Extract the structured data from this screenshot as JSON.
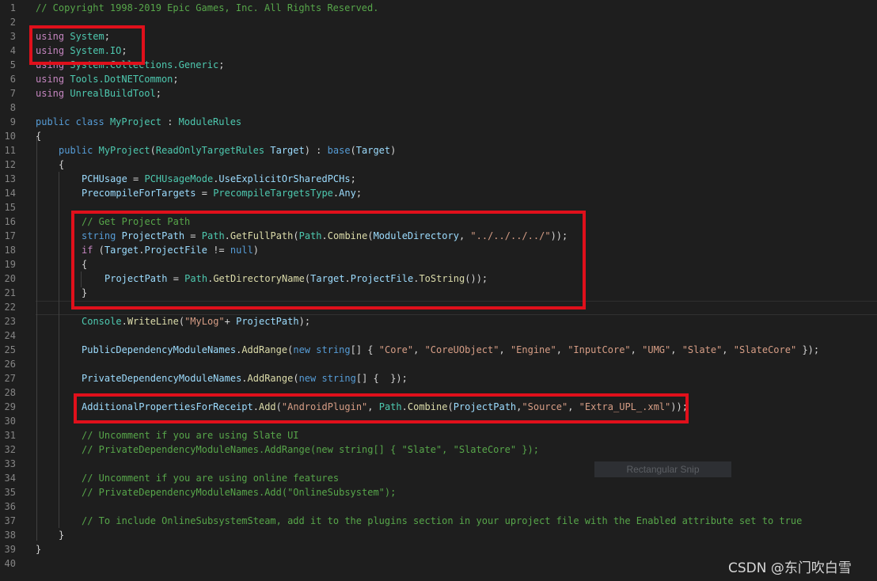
{
  "colors": {
    "comment": "#57a64a",
    "keyword": "#569cd6",
    "control": "#c586c0",
    "type": "#4ec9b0",
    "method": "#dcdcaa",
    "variable": "#9cdcfe",
    "string": "#d69d85",
    "plain": "#d4d4d4",
    "highlight_border": "#e0101b"
  },
  "lines": [
    {
      "n": "1",
      "indent": 0,
      "tokens": [
        [
          "c",
          "// Copyright 1998-2019 Epic Games, Inc. All Rights Reserved."
        ]
      ]
    },
    {
      "n": "2",
      "indent": 0,
      "tokens": []
    },
    {
      "n": "3",
      "indent": 0,
      "tokens": [
        [
          "ctl",
          "using"
        ],
        [
          "p",
          " "
        ],
        [
          "t",
          "System"
        ],
        [
          "p",
          ";"
        ]
      ]
    },
    {
      "n": "4",
      "indent": 0,
      "tokens": [
        [
          "ctl",
          "using"
        ],
        [
          "p",
          " "
        ],
        [
          "t",
          "System.IO"
        ],
        [
          "p",
          ";"
        ]
      ]
    },
    {
      "n": "5",
      "indent": 0,
      "tokens": [
        [
          "ctl",
          "using"
        ],
        [
          "p",
          " "
        ],
        [
          "t",
          "System.Collections.Generic"
        ],
        [
          "p",
          ";"
        ]
      ]
    },
    {
      "n": "6",
      "indent": 0,
      "tokens": [
        [
          "ctl",
          "using"
        ],
        [
          "p",
          " "
        ],
        [
          "t",
          "Tools.DotNETCommon"
        ],
        [
          "p",
          ";"
        ]
      ]
    },
    {
      "n": "7",
      "indent": 0,
      "tokens": [
        [
          "ctl",
          "using"
        ],
        [
          "p",
          " "
        ],
        [
          "t",
          "UnrealBuildTool"
        ],
        [
          "p",
          ";"
        ]
      ]
    },
    {
      "n": "8",
      "indent": 0,
      "tokens": []
    },
    {
      "n": "9",
      "indent": 0,
      "tokens": [
        [
          "k",
          "public"
        ],
        [
          "p",
          " "
        ],
        [
          "k",
          "class"
        ],
        [
          "p",
          " "
        ],
        [
          "t",
          "MyProject"
        ],
        [
          "p",
          " : "
        ],
        [
          "t",
          "ModuleRules"
        ]
      ]
    },
    {
      "n": "10",
      "indent": 0,
      "tokens": [
        [
          "p",
          "{"
        ]
      ]
    },
    {
      "n": "11",
      "indent": 1,
      "tokens": [
        [
          "k",
          "public"
        ],
        [
          "p",
          " "
        ],
        [
          "t",
          "MyProject"
        ],
        [
          "p",
          "("
        ],
        [
          "t",
          "ReadOnlyTargetRules"
        ],
        [
          "p",
          " "
        ],
        [
          "v",
          "Target"
        ],
        [
          "p",
          ") : "
        ],
        [
          "k",
          "base"
        ],
        [
          "p",
          "("
        ],
        [
          "v",
          "Target"
        ],
        [
          "p",
          ")"
        ]
      ]
    },
    {
      "n": "12",
      "indent": 1,
      "tokens": [
        [
          "p",
          "{"
        ]
      ]
    },
    {
      "n": "13",
      "indent": 2,
      "tokens": [
        [
          "v",
          "PCHUsage"
        ],
        [
          "p",
          " = "
        ],
        [
          "t",
          "PCHUsageMode"
        ],
        [
          "p",
          "."
        ],
        [
          "v",
          "UseExplicitOrSharedPCHs"
        ],
        [
          "p",
          ";"
        ]
      ]
    },
    {
      "n": "14",
      "indent": 2,
      "tokens": [
        [
          "v",
          "PrecompileForTargets"
        ],
        [
          "p",
          " = "
        ],
        [
          "t",
          "PrecompileTargetsType"
        ],
        [
          "p",
          "."
        ],
        [
          "v",
          "Any"
        ],
        [
          "p",
          ";"
        ]
      ]
    },
    {
      "n": "15",
      "indent": 2,
      "tokens": []
    },
    {
      "n": "16",
      "indent": 2,
      "tokens": [
        [
          "c",
          "// Get Project Path"
        ]
      ]
    },
    {
      "n": "17",
      "indent": 2,
      "tokens": [
        [
          "k",
          "string"
        ],
        [
          "p",
          " "
        ],
        [
          "v",
          "ProjectPath"
        ],
        [
          "p",
          " = "
        ],
        [
          "t",
          "Path"
        ],
        [
          "p",
          "."
        ],
        [
          "m",
          "GetFullPath"
        ],
        [
          "p",
          "("
        ],
        [
          "t",
          "Path"
        ],
        [
          "p",
          "."
        ],
        [
          "m",
          "Combine"
        ],
        [
          "p",
          "("
        ],
        [
          "v",
          "ModuleDirectory"
        ],
        [
          "p",
          ", "
        ],
        [
          "s",
          "\"../../../../\""
        ],
        [
          "p",
          "));"
        ]
      ]
    },
    {
      "n": "18",
      "indent": 2,
      "tokens": [
        [
          "ctl",
          "if"
        ],
        [
          "p",
          " ("
        ],
        [
          "v",
          "Target"
        ],
        [
          "p",
          "."
        ],
        [
          "v",
          "ProjectFile"
        ],
        [
          "p",
          " != "
        ],
        [
          "k",
          "null"
        ],
        [
          "p",
          ")"
        ]
      ]
    },
    {
      "n": "19",
      "indent": 2,
      "tokens": [
        [
          "p",
          "{"
        ]
      ]
    },
    {
      "n": "20",
      "indent": 3,
      "tokens": [
        [
          "v",
          "ProjectPath"
        ],
        [
          "p",
          " = "
        ],
        [
          "t",
          "Path"
        ],
        [
          "p",
          "."
        ],
        [
          "m",
          "GetDirectoryName"
        ],
        [
          "p",
          "("
        ],
        [
          "v",
          "Target"
        ],
        [
          "p",
          "."
        ],
        [
          "v",
          "ProjectFile"
        ],
        [
          "p",
          "."
        ],
        [
          "m",
          "ToString"
        ],
        [
          "p",
          "());"
        ]
      ]
    },
    {
      "n": "21",
      "indent": 2,
      "tokens": [
        [
          "p",
          "}"
        ]
      ]
    },
    {
      "n": "22",
      "indent": 2,
      "tokens": []
    },
    {
      "n": "23",
      "indent": 2,
      "tokens": [
        [
          "t",
          "Console"
        ],
        [
          "p",
          "."
        ],
        [
          "m",
          "WriteLine"
        ],
        [
          "p",
          "("
        ],
        [
          "s",
          "\"MyLog\""
        ],
        [
          "p",
          "+ "
        ],
        [
          "v",
          "ProjectPath"
        ],
        [
          "p",
          ");"
        ]
      ]
    },
    {
      "n": "24",
      "indent": 2,
      "tokens": []
    },
    {
      "n": "25",
      "indent": 2,
      "tokens": [
        [
          "v",
          "PublicDependencyModuleNames"
        ],
        [
          "p",
          "."
        ],
        [
          "m",
          "AddRange"
        ],
        [
          "p",
          "("
        ],
        [
          "k",
          "new"
        ],
        [
          "p",
          " "
        ],
        [
          "k",
          "string"
        ],
        [
          "p",
          "[] { "
        ],
        [
          "s",
          "\"Core\""
        ],
        [
          "p",
          ", "
        ],
        [
          "s",
          "\"CoreUObject\""
        ],
        [
          "p",
          ", "
        ],
        [
          "s",
          "\"Engine\""
        ],
        [
          "p",
          ", "
        ],
        [
          "s",
          "\"InputCore\""
        ],
        [
          "p",
          ", "
        ],
        [
          "s",
          "\"UMG\""
        ],
        [
          "p",
          ", "
        ],
        [
          "s",
          "\"Slate\""
        ],
        [
          "p",
          ", "
        ],
        [
          "s",
          "\"SlateCore\""
        ],
        [
          "p",
          " });"
        ]
      ]
    },
    {
      "n": "26",
      "indent": 2,
      "tokens": []
    },
    {
      "n": "27",
      "indent": 2,
      "tokens": [
        [
          "v",
          "PrivateDependencyModuleNames"
        ],
        [
          "p",
          "."
        ],
        [
          "m",
          "AddRange"
        ],
        [
          "p",
          "("
        ],
        [
          "k",
          "new"
        ],
        [
          "p",
          " "
        ],
        [
          "k",
          "string"
        ],
        [
          "p",
          "[] {  });"
        ]
      ]
    },
    {
      "n": "28",
      "indent": 2,
      "tokens": []
    },
    {
      "n": "29",
      "indent": 2,
      "tokens": [
        [
          "v",
          "AdditionalPropertiesForReceipt"
        ],
        [
          "p",
          "."
        ],
        [
          "m",
          "Add"
        ],
        [
          "p",
          "("
        ],
        [
          "s",
          "\"AndroidPlugin\""
        ],
        [
          "p",
          ", "
        ],
        [
          "t",
          "Path"
        ],
        [
          "p",
          "."
        ],
        [
          "m",
          "Combine"
        ],
        [
          "p",
          "("
        ],
        [
          "v",
          "ProjectPath"
        ],
        [
          "p",
          ","
        ],
        [
          "s",
          "\"Source\""
        ],
        [
          "p",
          ", "
        ],
        [
          "s",
          "\"Extra_UPL_.xml\""
        ],
        [
          "p",
          "));"
        ]
      ]
    },
    {
      "n": "30",
      "indent": 2,
      "tokens": []
    },
    {
      "n": "31",
      "indent": 2,
      "tokens": [
        [
          "c",
          "// Uncomment if you are using Slate UI"
        ]
      ]
    },
    {
      "n": "32",
      "indent": 2,
      "tokens": [
        [
          "c",
          "// PrivateDependencyModuleNames.AddRange(new string[] { \"Slate\", \"SlateCore\" });"
        ]
      ]
    },
    {
      "n": "33",
      "indent": 2,
      "tokens": []
    },
    {
      "n": "34",
      "indent": 2,
      "tokens": [
        [
          "c",
          "// Uncomment if you are using online features"
        ]
      ]
    },
    {
      "n": "35",
      "indent": 2,
      "tokens": [
        [
          "c",
          "// PrivateDependencyModuleNames.Add(\"OnlineSubsystem\");"
        ]
      ]
    },
    {
      "n": "36",
      "indent": 2,
      "tokens": []
    },
    {
      "n": "37",
      "indent": 2,
      "tokens": [
        [
          "c",
          "// To include OnlineSubsystemSteam, add it to the plugins section in your uproject file with the Enabled attribute set to true"
        ]
      ]
    },
    {
      "n": "38",
      "indent": 1,
      "tokens": [
        [
          "p",
          "}"
        ]
      ]
    },
    {
      "n": "39",
      "indent": 0,
      "tokens": [
        [
          "p",
          "}"
        ]
      ]
    },
    {
      "n": "40",
      "indent": 0,
      "tokens": []
    }
  ],
  "overlay": {
    "tooltip": "Rectangular Snip",
    "watermark": "CSDN @东门吹白雪"
  }
}
